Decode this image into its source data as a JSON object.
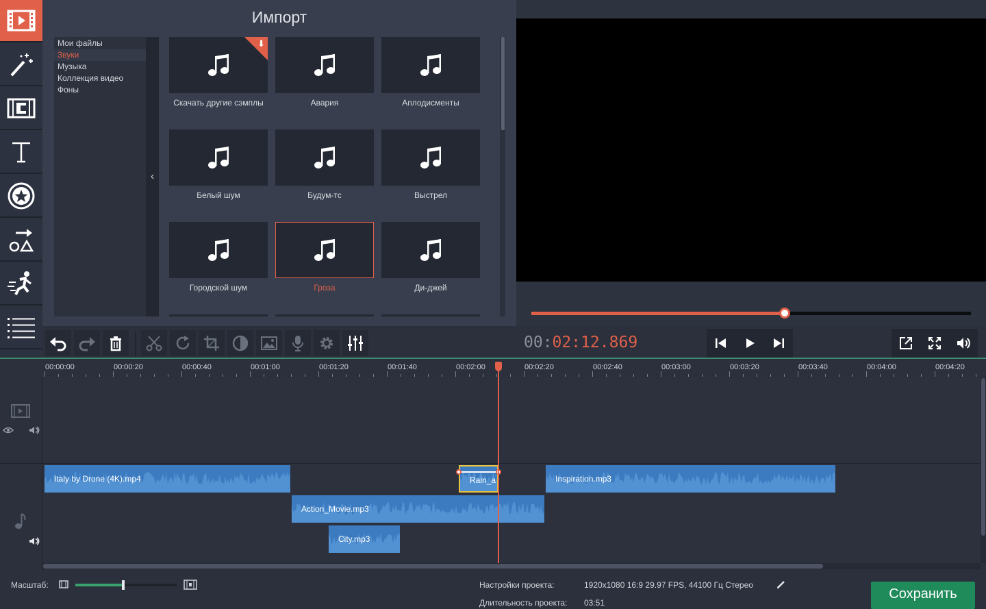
{
  "sidebar": {
    "tools": [
      {
        "name": "import-tool",
        "icon": "film-import-icon"
      },
      {
        "name": "filters-tool",
        "icon": "magic-wand-icon"
      },
      {
        "name": "transitions-tool",
        "icon": "film-transition-icon"
      },
      {
        "name": "titles-tool",
        "icon": "text-icon"
      },
      {
        "name": "stickers-tool",
        "icon": "sticker-star-icon"
      },
      {
        "name": "callouts-tool",
        "icon": "shapes-arrow-icon"
      },
      {
        "name": "motion-tool",
        "icon": "running-man-icon"
      },
      {
        "name": "more-tool",
        "icon": "list-icon"
      }
    ]
  },
  "import_panel": {
    "title": "Импорт",
    "categories": [
      "Мои файлы",
      "Звуки",
      "Музыка",
      "Коллекция видео",
      "Фоны"
    ],
    "selected_category": "Звуки",
    "tiles": [
      {
        "label": "Скачать другие сэмплы",
        "download": true
      },
      {
        "label": "Авария"
      },
      {
        "label": "Аплодисменты"
      },
      {
        "label": "Белый шум"
      },
      {
        "label": "Будум-тс"
      },
      {
        "label": "Выстрел"
      },
      {
        "label": "Городской шум"
      },
      {
        "label": "Гроза",
        "selected": true
      },
      {
        "label": "Ди-джей"
      }
    ]
  },
  "player": {
    "progress": 0.577,
    "timecode_dim": "00:",
    "timecode_active": "02:12.869"
  },
  "timeline": {
    "ticks": [
      "00:00:00",
      "00:00:20",
      "00:00:40",
      "00:01:00",
      "00:01:20",
      "00:01:40",
      "00:02:00",
      "00:02:20",
      "00:02:40",
      "00:03:00",
      "00:03:20",
      "00:03:40",
      "00:04:00",
      "00:04:20"
    ],
    "clips": [
      {
        "id": "italy",
        "name": "Italy by Drone (4K).mp4"
      },
      {
        "id": "rain",
        "name": "Rain_a"
      },
      {
        "id": "inspiration",
        "name": "Inspiration.mp3"
      },
      {
        "id": "action",
        "name": "Action_Movie.mp3"
      },
      {
        "id": "city",
        "name": "City.mp3"
      }
    ]
  },
  "footer": {
    "scale_label": "Масштаб:",
    "zoom": 0.47,
    "project_settings_label": "Настройки проекта:",
    "project_settings_value": "1920x1080 16:9 29.97 FPS, 44100 Гц Стерео",
    "duration_label": "Длительность проекта:",
    "duration_value": "03:51",
    "save_label": "Сохранить"
  },
  "colors": {
    "accent": "#e0604a",
    "clip": "#3c7bc0",
    "save": "#1f8a5a",
    "zoom": "#3aa06e"
  }
}
